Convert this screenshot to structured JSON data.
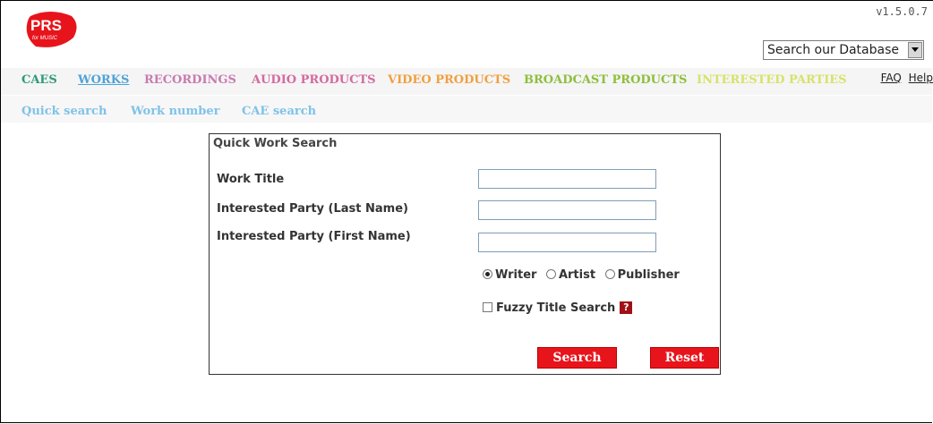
{
  "app": {
    "version": "v1.5.0.7",
    "logo_text": "PRS",
    "logo_sub": "for MUSIC"
  },
  "database_select": {
    "selected": "Search our Database"
  },
  "help_links": {
    "faq": "FAQ",
    "help": "Help"
  },
  "tabs": [
    {
      "label": "CAES",
      "color": "#2e9a7a",
      "active": false
    },
    {
      "label": "WORKS",
      "color": "#4fa3d8",
      "active": true
    },
    {
      "label": "RECORDINGS",
      "color": "#c87bb0",
      "active": false
    },
    {
      "label": "AUDIO PRODUCTS",
      "color": "#d46ba0",
      "active": false
    },
    {
      "label": "VIDEO PRODUCTS",
      "color": "#f0a040",
      "active": false
    },
    {
      "label": "BROADCAST PRODUCTS",
      "color": "#8dbf3d",
      "active": false
    },
    {
      "label": "INTERESTED PARTIES",
      "color": "#d7e26a",
      "active": false
    }
  ],
  "subnav": [
    {
      "label": "Quick search"
    },
    {
      "label": "Work number"
    },
    {
      "label": "CAE search"
    }
  ],
  "form": {
    "title": "Quick Work Search",
    "fields": [
      {
        "label": "Work Title",
        "value": ""
      },
      {
        "label": "Interested Party (Last Name)",
        "value": ""
      },
      {
        "label": "Interested Party (First Name)",
        "value": ""
      }
    ],
    "radio_options": [
      {
        "label": "Writer",
        "selected": true
      },
      {
        "label": "Artist",
        "selected": false
      },
      {
        "label": "Publisher",
        "selected": false
      }
    ],
    "fuzzy_label": "Fuzzy Title Search",
    "fuzzy_checked": false,
    "help_icon": "?",
    "search_label": "Search",
    "reset_label": "Reset"
  },
  "colors": {
    "brand_red": "#e8141c",
    "help_red": "#a01016"
  }
}
